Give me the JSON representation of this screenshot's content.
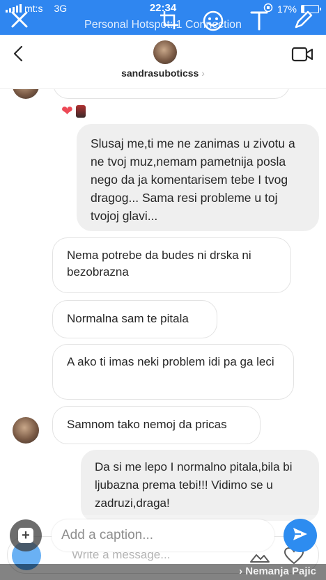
{
  "status": {
    "carrier": "mt:s",
    "network": "3G",
    "time": "22:34",
    "battery_text": "17%",
    "battery_level": 0.17,
    "hotspot": "Personal Hotspot: 1 Connection"
  },
  "overlay_tools": [
    "close-icon",
    "crop-icon",
    "sticker-icon",
    "text-icon",
    "pen-icon"
  ],
  "header": {
    "username": "sandrasuboticss",
    "chevron": "›"
  },
  "messages": [
    {
      "side": "out",
      "text": "Slusaj me,ti me ne zanimas u zivotu a ne tvoj muz,nemam pametnija posla nego da ja komentarisem tebe I tvog dragog... Sama resi probleme u toj tvojoj glavi..."
    },
    {
      "side": "in",
      "text": "Nema potrebe da budes ni drska ni bezobrazna"
    },
    {
      "side": "in",
      "text": "Normalna sam te pitala"
    },
    {
      "side": "in",
      "text": "A ako ti imas neki problem idi pa ga leci"
    },
    {
      "side": "in",
      "text": "Samnom tako nemoj da pricas"
    },
    {
      "side": "out",
      "text": "Da si me lepo I normalno pitala,bila bi ljubazna prema tebi!!! Vidimo se u zadruzi,draga!"
    }
  ],
  "reactions": {
    "heart": "❤"
  },
  "composer": {
    "placeholder": "Write a message..."
  },
  "caption": {
    "placeholder": "Add a caption...",
    "add_symbol": "+"
  },
  "watermark": "› Nemanja Pajic",
  "colors": {
    "accent": "#2f86f0",
    "send": "#2d8cf0",
    "heart": "#ed4956"
  }
}
